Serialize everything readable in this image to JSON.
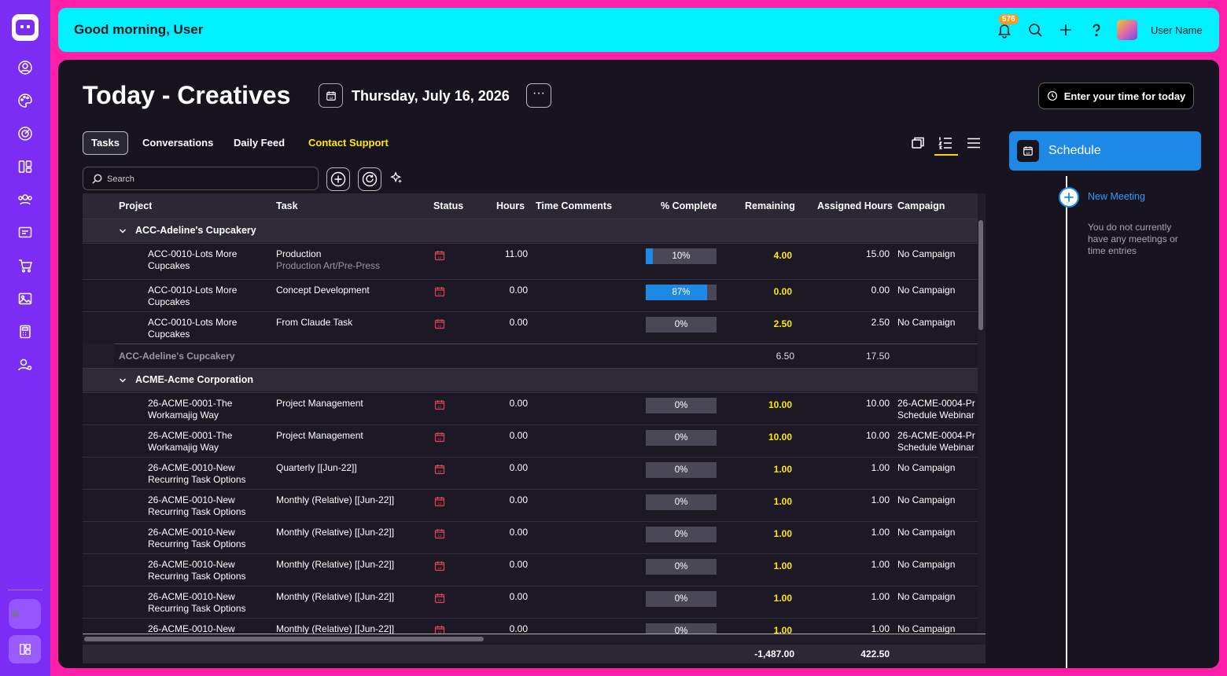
{
  "topbar": {
    "greeting": "Good morning, User",
    "notification_count": "576",
    "user_name": "User Name"
  },
  "page": {
    "title": "Today - Creatives",
    "date": "Thursday, July 16, 2026",
    "more": "···",
    "enter_time_label": "Enter your time for today"
  },
  "tabs": [
    {
      "label": "Tasks",
      "active": true
    },
    {
      "label": "Conversations"
    },
    {
      "label": "Daily Feed"
    },
    {
      "label": "Contact Support"
    }
  ],
  "search": {
    "placeholder": "Search"
  },
  "table": {
    "headers": [
      "Project",
      "Task",
      "Status",
      "Hours",
      "Time Comments",
      "% Complete",
      "Remaining",
      "Assigned Hours",
      "Campaign"
    ],
    "groups": [
      {
        "name": "ACC-Adeline's Cupcakery",
        "rows": [
          {
            "project": [
              "ACC-0010-Lots More",
              "Cupcakes"
            ],
            "task": "Production",
            "task_sub": "Production Art/Pre-Press",
            "hours": "11.00",
            "pct": 10,
            "pct_label": "10%",
            "remaining": "4.00",
            "assigned": "15.00",
            "campaign": [
              "No Campaign"
            ]
          },
          {
            "project": [
              "ACC-0010-Lots More",
              "Cupcakes"
            ],
            "task": "Concept Development",
            "task_sub": "",
            "hours": "0.00",
            "pct": 87,
            "pct_label": "87%",
            "remaining": "0.00",
            "assigned": "0.00",
            "campaign": [
              "No Campaign"
            ]
          },
          {
            "project": [
              "ACC-0010-Lots More",
              "Cupcakes"
            ],
            "task": "From Claude Task",
            "task_sub": "",
            "hours": "0.00",
            "pct": 0,
            "pct_label": "0%",
            "remaining": "2.50",
            "assigned": "2.50",
            "campaign": [
              "No Campaign"
            ]
          }
        ],
        "subtotal": {
          "label": "ACC-Adeline's Cupcakery",
          "remaining": "6.50",
          "assigned": "17.50"
        }
      },
      {
        "name": "ACME-Acme Corporation",
        "rows": [
          {
            "project": [
              "26-ACME-0001-The",
              "Workamajig Way"
            ],
            "task": "Project Management",
            "task_sub": "",
            "hours": "0.00",
            "pct": 0,
            "pct_label": "0%",
            "remaining": "10.00",
            "assigned": "10.00",
            "campaign": [
              "26-ACME-0004-Pr",
              "Schedule Webinar"
            ]
          },
          {
            "project": [
              "26-ACME-0001-The",
              "Workamajig Way"
            ],
            "task": "Project Management",
            "task_sub": "",
            "hours": "0.00",
            "pct": 0,
            "pct_label": "0%",
            "remaining": "10.00",
            "assigned": "10.00",
            "campaign": [
              "26-ACME-0004-Pr",
              "Schedule Webinar"
            ]
          },
          {
            "project": [
              "26-ACME-0010-New",
              "Recurring Task Options"
            ],
            "task": "Quarterly [[Jun-22]]",
            "task_sub": "",
            "hours": "0.00",
            "pct": 0,
            "pct_label": "0%",
            "remaining": "1.00",
            "assigned": "1.00",
            "campaign": [
              "No Campaign"
            ]
          },
          {
            "project": [
              "26-ACME-0010-New",
              "Recurring Task Options"
            ],
            "task": "Monthly (Relative) [[Jun-22]]",
            "task_sub": "",
            "hours": "0.00",
            "pct": 0,
            "pct_label": "0%",
            "remaining": "1.00",
            "assigned": "1.00",
            "campaign": [
              "No Campaign"
            ]
          },
          {
            "project": [
              "26-ACME-0010-New",
              "Recurring Task Options"
            ],
            "task": "Monthly (Relative) [[Jun-22]]",
            "task_sub": "",
            "hours": "0.00",
            "pct": 0,
            "pct_label": "0%",
            "remaining": "1.00",
            "assigned": "1.00",
            "campaign": [
              "No Campaign"
            ]
          },
          {
            "project": [
              "26-ACME-0010-New",
              "Recurring Task Options"
            ],
            "task": "Monthly (Relative) [[Jun-22]]",
            "task_sub": "",
            "hours": "0.00",
            "pct": 0,
            "pct_label": "0%",
            "remaining": "1.00",
            "assigned": "1.00",
            "campaign": [
              "No Campaign"
            ]
          },
          {
            "project": [
              "26-ACME-0010-New",
              "Recurring Task Options"
            ],
            "task": "Monthly (Relative) [[Jun-22]]",
            "task_sub": "",
            "hours": "0.00",
            "pct": 0,
            "pct_label": "0%",
            "remaining": "1.00",
            "assigned": "1.00",
            "campaign": [
              "No Campaign"
            ]
          },
          {
            "project": [
              "26-ACME-0010-New",
              ""
            ],
            "task": "Monthly (Relative) [[Jun-22]]",
            "task_sub": "",
            "hours": "0.00",
            "pct": 0,
            "pct_label": "0%",
            "remaining": "1.00",
            "assigned": "1.00",
            "campaign": [
              "No Campaign"
            ]
          }
        ]
      }
    ],
    "totals": {
      "remaining": "-1,487.00",
      "assigned": "422.50"
    }
  },
  "schedule": {
    "title": "Schedule",
    "new_meeting": "New Meeting",
    "empty_text": "You do not currently have any meetings or time entries"
  },
  "colors": {
    "background": "#ff1fa8",
    "sidebar": "#7b2cf5",
    "topbar": "#00f0ff",
    "panel": "#17131f",
    "accent_blue": "#1e88e5",
    "highlight_yellow": "#ffea00",
    "status_red": "#e0435a"
  }
}
